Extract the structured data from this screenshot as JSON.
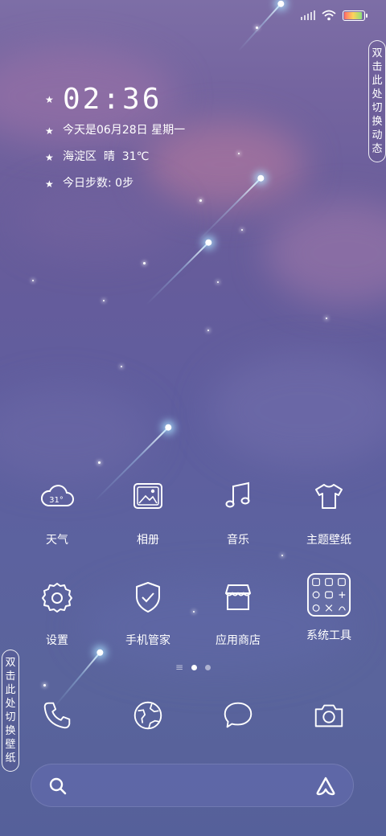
{
  "status_bar": {
    "battery_level": 0.9
  },
  "side_tabs": {
    "right": [
      "双",
      "击",
      "此",
      "处",
      "切",
      "换",
      "动",
      "态"
    ],
    "left": [
      "双",
      "击",
      "此",
      "处",
      "切",
      "换",
      "壁",
      "纸"
    ]
  },
  "widget": {
    "time": "02:36",
    "date": "今天是06月28日 星期一",
    "weather": "海淀区  晴  31℃",
    "steps": "今日步数: 0步"
  },
  "apps": [
    {
      "label": "天气",
      "icon": "weather-cloud-icon",
      "temp": "31°"
    },
    {
      "label": "相册",
      "icon": "gallery-icon"
    },
    {
      "label": "音乐",
      "icon": "music-icon"
    },
    {
      "label": "主题壁纸",
      "icon": "theme-shirt-icon"
    },
    {
      "label": "设置",
      "icon": "settings-gear-icon"
    },
    {
      "label": "手机管家",
      "icon": "security-shield-icon"
    },
    {
      "label": "应用商店",
      "icon": "app-store-icon"
    },
    {
      "label": "系统工具",
      "icon": "system-tools-folder-icon"
    }
  ],
  "page_indicator": {
    "pages": 2,
    "active": 1
  },
  "dock": [
    {
      "icon": "phone-icon"
    },
    {
      "icon": "browser-globe-icon"
    },
    {
      "icon": "messages-bubble-icon"
    },
    {
      "icon": "camera-icon"
    }
  ],
  "search": {
    "left_icon": "search-icon",
    "right_icon": "assistant-icon"
  },
  "colors": {
    "sky_top": "#7d6ea6",
    "sky_bottom": "#55609a",
    "text": "#ffffff"
  }
}
